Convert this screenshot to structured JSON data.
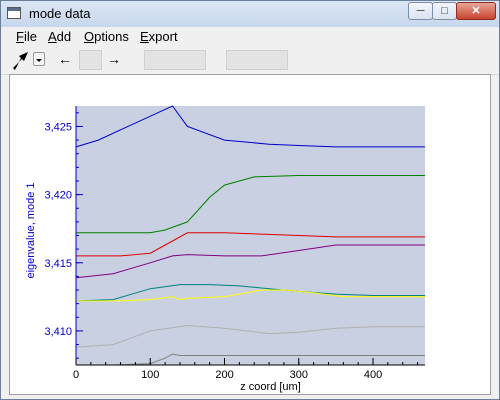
{
  "window": {
    "title": "mode data"
  },
  "titlebar_buttons": {
    "minimize": "─",
    "maximize": "□",
    "close": "✕"
  },
  "menu": {
    "items": [
      "File",
      "Add",
      "Options",
      "Export"
    ]
  },
  "toolbar": {
    "icons": [
      "cursor-arrow-icon",
      "back-arrow-icon",
      "forward-arrow-icon"
    ],
    "back_label": "←",
    "forward_label": "→"
  },
  "chart_data": {
    "type": "line",
    "title": "",
    "xlabel": "z coord [um]",
    "ylabel": "eigenvalue, mode 1",
    "xlim": [
      0,
      470
    ],
    "ylim": [
      3.4075,
      3.4265
    ],
    "xticks": [
      0,
      100,
      200,
      300,
      400
    ],
    "xtick_labels": [
      "0",
      "100",
      "200",
      "300",
      "400"
    ],
    "yticks": [
      3.41,
      3.415,
      3.42,
      3.425
    ],
    "ytick_labels": [
      "3,410",
      "3,415",
      "3,420",
      "3,425"
    ],
    "grid": false,
    "background": "#c8d0e1",
    "series": [
      {
        "color": "#0000cc",
        "x": [
          0,
          30,
          70,
          110,
          130,
          150,
          200,
          260,
          300,
          350,
          400,
          470
        ],
        "y": [
          3.4235,
          3.424,
          3.425,
          3.426,
          3.4265,
          3.425,
          3.424,
          3.4237,
          3.4236,
          3.4235,
          3.4235,
          3.4235
        ]
      },
      {
        "color": "#008000",
        "x": [
          0,
          60,
          100,
          120,
          150,
          180,
          200,
          240,
          300,
          350,
          400,
          470
        ],
        "y": [
          3.4172,
          3.4172,
          3.4172,
          3.4174,
          3.418,
          3.4198,
          3.4207,
          3.4213,
          3.4214,
          3.4214,
          3.4214,
          3.4214
        ]
      },
      {
        "color": "#dd0000",
        "x": [
          0,
          60,
          100,
          130,
          150,
          200,
          250,
          300,
          350,
          400,
          470
        ],
        "y": [
          3.4155,
          3.4155,
          3.4157,
          3.4166,
          3.4172,
          3.4172,
          3.4171,
          3.417,
          3.4169,
          3.4169,
          3.4169
        ]
      },
      {
        "color": "#800080",
        "x": [
          0,
          50,
          100,
          130,
          150,
          200,
          250,
          300,
          350,
          400,
          470
        ],
        "y": [
          3.4139,
          3.4142,
          3.415,
          3.4155,
          3.4156,
          3.4155,
          3.4155,
          3.4159,
          3.4163,
          3.4163,
          3.4163
        ]
      },
      {
        "color": "#008080",
        "x": [
          0,
          50,
          100,
          140,
          180,
          220,
          260,
          300,
          350,
          400,
          470
        ],
        "y": [
          3.4122,
          3.4123,
          3.4131,
          3.4134,
          3.4134,
          3.4133,
          3.4131,
          3.4129,
          3.4127,
          3.4126,
          3.4126
        ]
      },
      {
        "color": "#ffff00",
        "x": [
          0,
          60,
          100,
          130,
          140,
          150,
          200,
          250,
          280,
          320,
          360,
          400,
          470
        ],
        "y": [
          3.4122,
          3.4122,
          3.4123,
          3.4125,
          3.4123,
          3.4124,
          3.4125,
          3.413,
          3.413,
          3.4128,
          3.4125,
          3.4125,
          3.4125
        ]
      },
      {
        "color": "#b0b0b0",
        "x": [
          0,
          50,
          100,
          150,
          200,
          260,
          300,
          350,
          400,
          470
        ],
        "y": [
          3.4088,
          3.409,
          3.41,
          3.4104,
          3.4102,
          3.4098,
          3.4099,
          3.4102,
          3.4103,
          3.4103
        ]
      },
      {
        "color": "#808080",
        "x": [
          0,
          50,
          100,
          120,
          130,
          140,
          200,
          300,
          400,
          470
        ],
        "y": [
          3.4075,
          3.4075,
          3.4076,
          3.408,
          3.4083,
          3.4082,
          3.4082,
          3.4082,
          3.4082,
          3.4082
        ]
      }
    ]
  }
}
